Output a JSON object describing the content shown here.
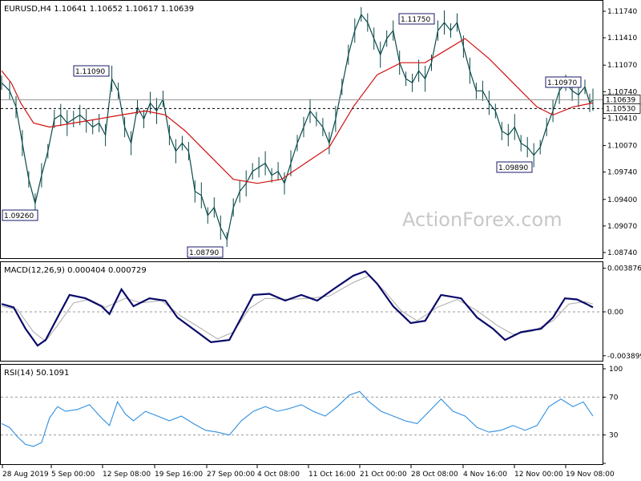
{
  "chart_data": {
    "type": "candlestick",
    "title": "EURUSD,H4  1.10641 1.10652 1.10617 1.10639",
    "watermark": "ActionForex.com",
    "x_ticks": [
      "28 Aug 2019",
      "5 Sep 00:00",
      "12 Sep 08:00",
      "19 Sep 16:00",
      "27 Sep 00:00",
      "4 Oct 08:00",
      "11 Oct 16:00",
      "21 Oct 00:00",
      "28 Oct 08:00",
      "4 Nov 16:00",
      "12 Nov 00:00",
      "19 Nov 08:00"
    ],
    "main": {
      "ylim": [
        1.0869,
        1.1184
      ],
      "y_ticks": [
        "1.11740",
        "1.11410",
        "1.11070",
        "1.10740",
        "1.10410",
        "1.10070",
        "1.09740",
        "1.09400",
        "1.09070",
        "1.08740"
      ],
      "current_price": "1.10639",
      "ref_price": "1.10530",
      "annotations": [
        {
          "label": "1.11090",
          "value": 1.1109
        },
        {
          "label": "1.09260",
          "value": 1.0926
        },
        {
          "label": "1.08790",
          "value": 1.0879
        },
        {
          "label": "1.11750",
          "value": 1.1175
        },
        {
          "label": "1.10970",
          "value": 1.1097
        },
        {
          "label": "1.09890",
          "value": 1.0989
        }
      ],
      "close_series": [
        {
          "x": 0,
          "y": 1.1085
        },
        {
          "x": 10,
          "y": 1.1075
        },
        {
          "x": 18,
          "y": 1.1055
        },
        {
          "x": 26,
          "y": 1.101
        },
        {
          "x": 34,
          "y": 1.0965
        },
        {
          "x": 42,
          "y": 1.0935
        },
        {
          "x": 50,
          "y": 1.097
        },
        {
          "x": 58,
          "y": 1.1
        },
        {
          "x": 66,
          "y": 1.104
        },
        {
          "x": 74,
          "y": 1.1045
        },
        {
          "x": 82,
          "y": 1.1035
        },
        {
          "x": 90,
          "y": 1.104
        },
        {
          "x": 98,
          "y": 1.1045
        },
        {
          "x": 106,
          "y": 1.1038
        },
        {
          "x": 114,
          "y": 1.103
        },
        {
          "x": 122,
          "y": 1.1035
        },
        {
          "x": 130,
          "y": 1.102
        },
        {
          "x": 138,
          "y": 1.109
        },
        {
          "x": 146,
          "y": 1.1075
        },
        {
          "x": 154,
          "y": 1.103
        },
        {
          "x": 162,
          "y": 1.101
        },
        {
          "x": 170,
          "y": 1.1055
        },
        {
          "x": 178,
          "y": 1.104
        },
        {
          "x": 186,
          "y": 1.106
        },
        {
          "x": 194,
          "y": 1.105
        },
        {
          "x": 202,
          "y": 1.1065
        },
        {
          "x": 210,
          "y": 1.102
        },
        {
          "x": 218,
          "y": 1.1
        },
        {
          "x": 226,
          "y": 1.101
        },
        {
          "x": 234,
          "y": 1.1
        },
        {
          "x": 242,
          "y": 1.095
        },
        {
          "x": 250,
          "y": 1.0945
        },
        {
          "x": 258,
          "y": 1.092
        },
        {
          "x": 266,
          "y": 1.093
        },
        {
          "x": 274,
          "y": 1.0905
        },
        {
          "x": 282,
          "y": 1.089
        },
        {
          "x": 290,
          "y": 1.093
        },
        {
          "x": 298,
          "y": 1.095
        },
        {
          "x": 306,
          "y": 1.096
        },
        {
          "x": 314,
          "y": 1.0975
        },
        {
          "x": 322,
          "y": 1.098
        },
        {
          "x": 330,
          "y": 1.0985
        },
        {
          "x": 338,
          "y": 1.097
        },
        {
          "x": 346,
          "y": 1.0975
        },
        {
          "x": 354,
          "y": 1.096
        },
        {
          "x": 362,
          "y": 1.0985
        },
        {
          "x": 370,
          "y": 1.101
        },
        {
          "x": 378,
          "y": 1.103
        },
        {
          "x": 386,
          "y": 1.105
        },
        {
          "x": 394,
          "y": 1.104
        },
        {
          "x": 402,
          "y": 1.103
        },
        {
          "x": 410,
          "y": 1.101
        },
        {
          "x": 418,
          "y": 1.104
        },
        {
          "x": 426,
          "y": 1.108
        },
        {
          "x": 434,
          "y": 1.112
        },
        {
          "x": 442,
          "y": 1.115
        },
        {
          "x": 450,
          "y": 1.117
        },
        {
          "x": 458,
          "y": 1.116
        },
        {
          "x": 466,
          "y": 1.114
        },
        {
          "x": 474,
          "y": 1.112
        },
        {
          "x": 482,
          "y": 1.114
        },
        {
          "x": 490,
          "y": 1.115
        },
        {
          "x": 498,
          "y": 1.111
        },
        {
          "x": 506,
          "y": 1.109
        },
        {
          "x": 514,
          "y": 1.1085
        },
        {
          "x": 522,
          "y": 1.11
        },
        {
          "x": 530,
          "y": 1.109
        },
        {
          "x": 538,
          "y": 1.111
        },
        {
          "x": 546,
          "y": 1.115
        },
        {
          "x": 554,
          "y": 1.116
        },
        {
          "x": 562,
          "y": 1.115
        },
        {
          "x": 570,
          "y": 1.116
        },
        {
          "x": 578,
          "y": 1.113
        },
        {
          "x": 586,
          "y": 1.11
        },
        {
          "x": 594,
          "y": 1.1075
        },
        {
          "x": 602,
          "y": 1.1075
        },
        {
          "x": 610,
          "y": 1.106
        },
        {
          "x": 618,
          "y": 1.105
        },
        {
          "x": 626,
          "y": 1.1025
        },
        {
          "x": 634,
          "y": 1.102
        },
        {
          "x": 642,
          "y": 1.103
        },
        {
          "x": 650,
          "y": 1.101
        },
        {
          "x": 658,
          "y": 1.1005
        },
        {
          "x": 666,
          "y": 1.0995
        },
        {
          "x": 674,
          "y": 1.1005
        },
        {
          "x": 682,
          "y": 1.103
        },
        {
          "x": 690,
          "y": 1.105
        },
        {
          "x": 698,
          "y": 1.1075
        },
        {
          "x": 706,
          "y": 1.1085
        },
        {
          "x": 714,
          "y": 1.1075
        },
        {
          "x": 722,
          "y": 1.107
        },
        {
          "x": 730,
          "y": 1.108
        },
        {
          "x": 736,
          "y": 1.106
        },
        {
          "x": 740,
          "y": 1.1064
        }
      ],
      "ma_series": [
        {
          "x": 0,
          "y": 1.11
        },
        {
          "x": 12,
          "y": 1.1085
        },
        {
          "x": 24,
          "y": 1.106
        },
        {
          "x": 40,
          "y": 1.1035
        },
        {
          "x": 60,
          "y": 1.103
        },
        {
          "x": 90,
          "y": 1.1035
        },
        {
          "x": 120,
          "y": 1.104
        },
        {
          "x": 150,
          "y": 1.1045
        },
        {
          "x": 180,
          "y": 1.105
        },
        {
          "x": 205,
          "y": 1.1045
        },
        {
          "x": 230,
          "y": 1.1025
        },
        {
          "x": 260,
          "y": 1.0995
        },
        {
          "x": 290,
          "y": 1.0965
        },
        {
          "x": 320,
          "y": 1.096
        },
        {
          "x": 350,
          "y": 1.0965
        },
        {
          "x": 380,
          "y": 1.0985
        },
        {
          "x": 410,
          "y": 1.1005
        },
        {
          "x": 440,
          "y": 1.1055
        },
        {
          "x": 470,
          "y": 1.1095
        },
        {
          "x": 500,
          "y": 1.111
        },
        {
          "x": 530,
          "y": 1.111
        },
        {
          "x": 555,
          "y": 1.1125
        },
        {
          "x": 580,
          "y": 1.114
        },
        {
          "x": 610,
          "y": 1.1115
        },
        {
          "x": 640,
          "y": 1.1085
        },
        {
          "x": 670,
          "y": 1.1055
        },
        {
          "x": 690,
          "y": 1.1045
        },
        {
          "x": 715,
          "y": 1.1055
        },
        {
          "x": 740,
          "y": 1.106
        }
      ]
    },
    "macd": {
      "label": "MACD(12,26,9) 0.000404 0.000729",
      "ylim": [
        -0.0042,
        0.0042
      ],
      "y_ticks": [
        "0.003876",
        "0.00",
        "-0.003899"
      ],
      "zero_label": "0.00",
      "macd_series": [
        {
          "x": 0,
          "y": 0.0007
        },
        {
          "x": 15,
          "y": 0.0004
        },
        {
          "x": 30,
          "y": -0.0015
        },
        {
          "x": 45,
          "y": -0.003
        },
        {
          "x": 55,
          "y": -0.0025
        },
        {
          "x": 70,
          "y": -0.0005
        },
        {
          "x": 85,
          "y": 0.0015
        },
        {
          "x": 105,
          "y": 0.0012
        },
        {
          "x": 125,
          "y": 0.0005
        },
        {
          "x": 135,
          "y": -0.0002
        },
        {
          "x": 150,
          "y": 0.002
        },
        {
          "x": 165,
          "y": 0.0005
        },
        {
          "x": 185,
          "y": 0.0012
        },
        {
          "x": 205,
          "y": 0.001
        },
        {
          "x": 220,
          "y": -0.0005
        },
        {
          "x": 245,
          "y": -0.0018
        },
        {
          "x": 262,
          "y": -0.0027
        },
        {
          "x": 285,
          "y": -0.0025
        },
        {
          "x": 300,
          "y": -0.0005
        },
        {
          "x": 315,
          "y": 0.0015
        },
        {
          "x": 335,
          "y": 0.0016
        },
        {
          "x": 355,
          "y": 0.001
        },
        {
          "x": 375,
          "y": 0.0015
        },
        {
          "x": 395,
          "y": 0.001
        },
        {
          "x": 415,
          "y": 0.002
        },
        {
          "x": 440,
          "y": 0.0032
        },
        {
          "x": 455,
          "y": 0.0036
        },
        {
          "x": 470,
          "y": 0.0025
        },
        {
          "x": 490,
          "y": 0.0005
        },
        {
          "x": 512,
          "y": -0.001
        },
        {
          "x": 530,
          "y": -0.0008
        },
        {
          "x": 550,
          "y": 0.0015
        },
        {
          "x": 575,
          "y": 0.0012
        },
        {
          "x": 595,
          "y": -0.0005
        },
        {
          "x": 615,
          "y": -0.0015
        },
        {
          "x": 630,
          "y": -0.0025
        },
        {
          "x": 650,
          "y": -0.0018
        },
        {
          "x": 675,
          "y": -0.0015
        },
        {
          "x": 690,
          "y": -0.0005
        },
        {
          "x": 705,
          "y": 0.0012
        },
        {
          "x": 720,
          "y": 0.0011
        },
        {
          "x": 732,
          "y": 0.0007
        },
        {
          "x": 740,
          "y": 0.0004
        }
      ],
      "signal_series": [
        {
          "x": 0,
          "y": 0.0005
        },
        {
          "x": 20,
          "y": 0.0002
        },
        {
          "x": 40,
          "y": -0.0018
        },
        {
          "x": 55,
          "y": -0.0026
        },
        {
          "x": 70,
          "y": -0.0012
        },
        {
          "x": 90,
          "y": 0.0008
        },
        {
          "x": 110,
          "y": 0.0011
        },
        {
          "x": 130,
          "y": 0.0004
        },
        {
          "x": 155,
          "y": 0.0012
        },
        {
          "x": 175,
          "y": 0.0008
        },
        {
          "x": 200,
          "y": 0.001
        },
        {
          "x": 225,
          "y": -0.0004
        },
        {
          "x": 250,
          "y": -0.0015
        },
        {
          "x": 270,
          "y": -0.0024
        },
        {
          "x": 290,
          "y": -0.0018
        },
        {
          "x": 310,
          "y": 0.0003
        },
        {
          "x": 330,
          "y": 0.0012
        },
        {
          "x": 360,
          "y": 0.0011
        },
        {
          "x": 385,
          "y": 0.0012
        },
        {
          "x": 410,
          "y": 0.0014
        },
        {
          "x": 440,
          "y": 0.0026
        },
        {
          "x": 460,
          "y": 0.0032
        },
        {
          "x": 480,
          "y": 0.0018
        },
        {
          "x": 500,
          "y": 0.0001
        },
        {
          "x": 520,
          "y": -0.0008
        },
        {
          "x": 545,
          "y": 0.0004
        },
        {
          "x": 570,
          "y": 0.0011
        },
        {
          "x": 595,
          "y": 0.0001
        },
        {
          "x": 620,
          "y": -0.0012
        },
        {
          "x": 640,
          "y": -0.002
        },
        {
          "x": 665,
          "y": -0.0017
        },
        {
          "x": 690,
          "y": -0.0008
        },
        {
          "x": 710,
          "y": 0.0007
        },
        {
          "x": 730,
          "y": 0.0009
        },
        {
          "x": 740,
          "y": 0.0007
        }
      ]
    },
    "rsi": {
      "label": "RSI(14) 50.1091",
      "ylim": [
        0,
        100
      ],
      "y_ticks": [
        "100",
        "70",
        "30",
        "0"
      ],
      "levels": [
        70,
        30
      ],
      "series": [
        {
          "x": 0,
          "y": 42
        },
        {
          "x": 10,
          "y": 38
        },
        {
          "x": 20,
          "y": 28
        },
        {
          "x": 30,
          "y": 20
        },
        {
          "x": 40,
          "y": 18
        },
        {
          "x": 50,
          "y": 22
        },
        {
          "x": 60,
          "y": 48
        },
        {
          "x": 70,
          "y": 60
        },
        {
          "x": 80,
          "y": 55
        },
        {
          "x": 95,
          "y": 57
        },
        {
          "x": 110,
          "y": 62
        },
        {
          "x": 125,
          "y": 48
        },
        {
          "x": 135,
          "y": 40
        },
        {
          "x": 145,
          "y": 65
        },
        {
          "x": 155,
          "y": 52
        },
        {
          "x": 165,
          "y": 45
        },
        {
          "x": 180,
          "y": 55
        },
        {
          "x": 195,
          "y": 50
        },
        {
          "x": 210,
          "y": 45
        },
        {
          "x": 225,
          "y": 50
        },
        {
          "x": 240,
          "y": 42
        },
        {
          "x": 255,
          "y": 35
        },
        {
          "x": 270,
          "y": 33
        },
        {
          "x": 285,
          "y": 30
        },
        {
          "x": 300,
          "y": 45
        },
        {
          "x": 315,
          "y": 55
        },
        {
          "x": 330,
          "y": 60
        },
        {
          "x": 345,
          "y": 55
        },
        {
          "x": 360,
          "y": 58
        },
        {
          "x": 375,
          "y": 62
        },
        {
          "x": 390,
          "y": 55
        },
        {
          "x": 405,
          "y": 50
        },
        {
          "x": 420,
          "y": 60
        },
        {
          "x": 435,
          "y": 72
        },
        {
          "x": 448,
          "y": 76
        },
        {
          "x": 460,
          "y": 65
        },
        {
          "x": 475,
          "y": 55
        },
        {
          "x": 490,
          "y": 50
        },
        {
          "x": 505,
          "y": 45
        },
        {
          "x": 520,
          "y": 42
        },
        {
          "x": 535,
          "y": 55
        },
        {
          "x": 550,
          "y": 68
        },
        {
          "x": 565,
          "y": 55
        },
        {
          "x": 580,
          "y": 50
        },
        {
          "x": 595,
          "y": 38
        },
        {
          "x": 610,
          "y": 33
        },
        {
          "x": 625,
          "y": 35
        },
        {
          "x": 640,
          "y": 40
        },
        {
          "x": 655,
          "y": 35
        },
        {
          "x": 670,
          "y": 40
        },
        {
          "x": 685,
          "y": 60
        },
        {
          "x": 700,
          "y": 68
        },
        {
          "x": 715,
          "y": 60
        },
        {
          "x": 728,
          "y": 65
        },
        {
          "x": 740,
          "y": 50
        }
      ]
    }
  }
}
